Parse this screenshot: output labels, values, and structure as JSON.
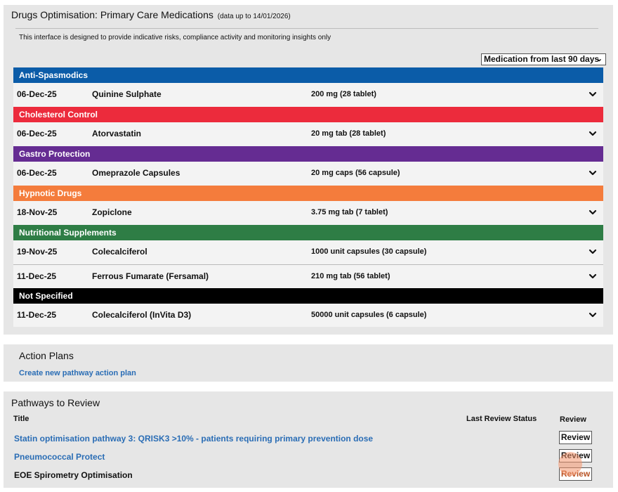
{
  "meds": {
    "title": "Drugs Optimisation: Primary Care Medications",
    "title_sub": "(data up to 14/01/2026)",
    "disclaimer": "This interface is designed to provide indicative risks, compliance activity and monitoring insights only",
    "range_select": "Medication from last 90 days",
    "categories": [
      {
        "name": "Anti-Spasmodics",
        "color": "#0b5ca8",
        "rows": [
          {
            "date": "06-Dec-25",
            "drug": "Quinine Sulphate",
            "strength": "200 mg (28 tablet)"
          }
        ]
      },
      {
        "name": "Cholesterol Control",
        "color": "#ec2b3c",
        "rows": [
          {
            "date": "06-Dec-25",
            "drug": "Atorvastatin",
            "strength": "20 mg tab (28 tablet)"
          }
        ]
      },
      {
        "name": "Gastro Protection",
        "color": "#652c92",
        "rows": [
          {
            "date": "06-Dec-25",
            "drug": "Omeprazole Capsules",
            "strength": "20 mg caps (56 capsule)"
          }
        ]
      },
      {
        "name": "Hypnotic Drugs",
        "color": "#f47c3c",
        "rows": [
          {
            "date": "18-Nov-25",
            "drug": "Zopiclone",
            "strength": "3.75 mg tab (7 tablet)"
          }
        ]
      },
      {
        "name": "Nutritional Supplements",
        "color": "#2e7d45",
        "rows": [
          {
            "date": "19-Nov-25",
            "drug": "Colecalciferol",
            "strength": "1000 unit capsules (30 capsule)"
          },
          {
            "date": "11-Dec-25",
            "drug": "Ferrous Fumarate (Fersamal)",
            "strength": "210 mg tab (56 tablet)"
          }
        ]
      },
      {
        "name": "Not Specified",
        "color": "#000000",
        "rows": [
          {
            "date": "11-Dec-25",
            "drug": "Colecalciferol (InVita D3)",
            "strength": "50000 unit capsules (6 capsule)"
          }
        ]
      }
    ]
  },
  "actions": {
    "title": "Action Plans",
    "create_link": "Create new pathway action plan"
  },
  "pathways": {
    "title": "Pathways to Review",
    "col_title": "Title",
    "col_status": "Last Review Status",
    "col_review": "Review",
    "review_label": "Review",
    "rows": [
      {
        "title": "Statin optimisation pathway 3: QRISK3 >10% - patients requiring primary prevention dose",
        "link": true
      },
      {
        "title": "Pneumococcal Protect",
        "link": true
      },
      {
        "title": "EOE Spirometry Optimisation",
        "link": false
      }
    ]
  },
  "colors": {
    "link": "#2a6db5",
    "panel": "#e6e6e6",
    "row": "#f3f3f3"
  },
  "icons": {
    "row_expand": "chevron-down-icon",
    "select": "chevron-down-icon"
  }
}
